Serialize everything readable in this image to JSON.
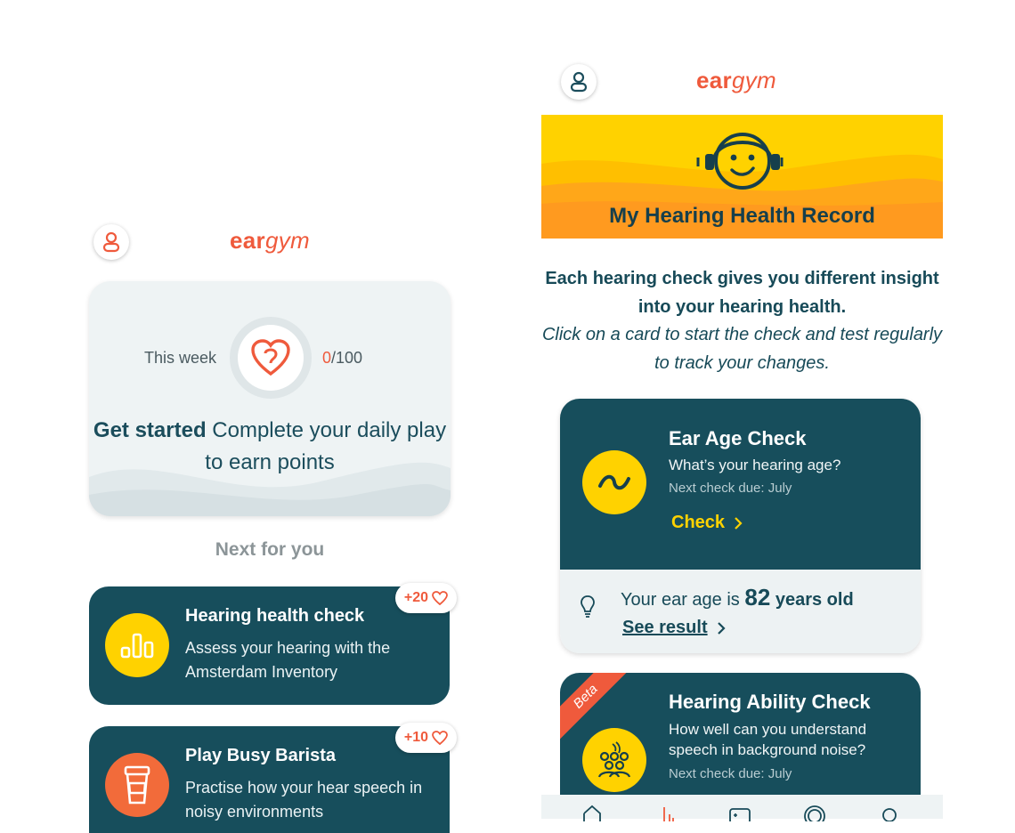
{
  "left": {
    "logo": {
      "bold": "ear",
      "italic": "gym"
    },
    "weekly": {
      "label": "This week",
      "points_current": "0",
      "points_total": "/100",
      "headline_bold": "Get started",
      "headline_rest": " Complete your daily play to earn points"
    },
    "next_heading": "Next for you",
    "activities": [
      {
        "title": "Hearing health check",
        "description": "Assess your hearing with the Amsterdam Inventory",
        "points": "+20",
        "icon": "bar-chart-icon",
        "icon_color": "#ffd200"
      },
      {
        "title": "Play Busy Barista",
        "description": "Practise how your hear speech in noisy environments",
        "points": "+10",
        "icon": "coffee-cup-icon",
        "icon_color": "#f26b3a"
      }
    ]
  },
  "right": {
    "logo": {
      "bold": "ear",
      "italic": "gym"
    },
    "banner_title": "My Hearing Health Record",
    "intro": {
      "bold": "Each hearing check gives you different insight into your hearing health.",
      "italic": "Click on a card to start the check and test regularly to track your changes."
    },
    "ear_age": {
      "title": "Ear Age Check",
      "subtitle": "What’s your hearing age?",
      "due": "Next check due: July",
      "action": "Check",
      "result_prefix": "Your ear age is ",
      "result_value": "82",
      "result_suffix": " years old",
      "see_result": "See result"
    },
    "ability": {
      "badge": "Beta",
      "title": "Hearing Ability Check",
      "subtitle": "How well can you understand speech in background noise?",
      "due": "Next check due: July"
    },
    "tabs": [
      "home-icon",
      "chart-icon",
      "game-icon",
      "hearing-icon",
      "search-icon"
    ]
  },
  "colors": {
    "brand": "#ef5a3c",
    "teal": "#174e5c",
    "yellow": "#ffd200"
  }
}
